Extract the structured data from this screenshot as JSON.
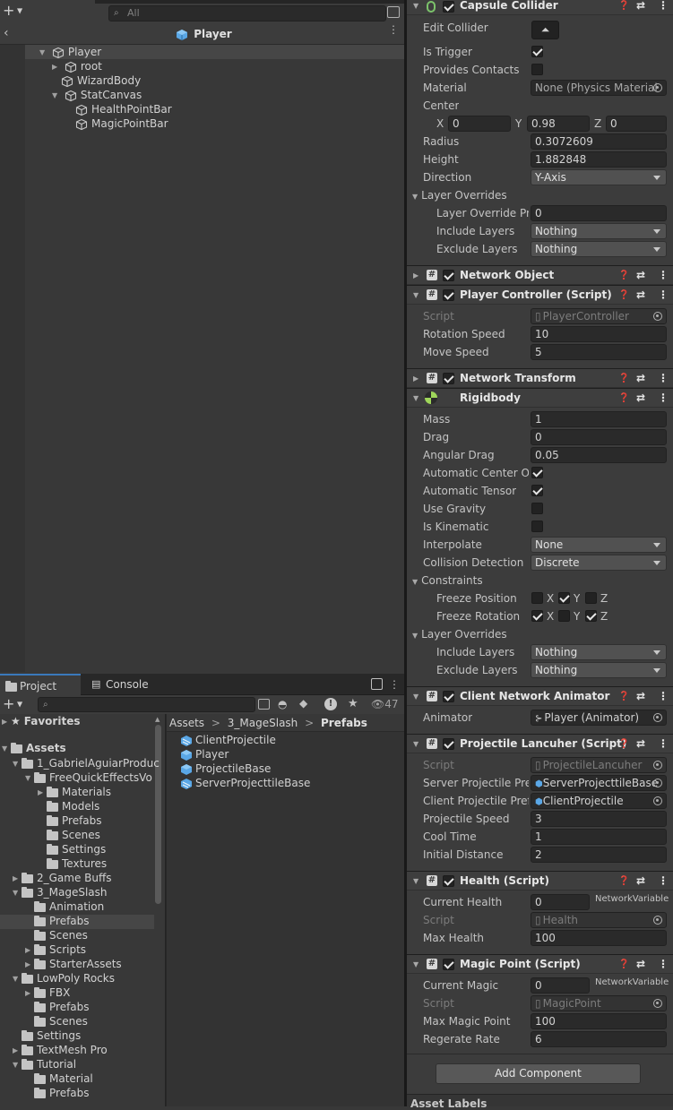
{
  "hierarchy": {
    "search_placeholder": "All",
    "header_title": "Player",
    "items": [
      {
        "label": "Player",
        "depth": 0
      },
      {
        "label": "root",
        "depth": 1
      },
      {
        "label": "WizardBody",
        "depth": 1
      },
      {
        "label": "StatCanvas",
        "depth": 1
      },
      {
        "label": "HealthPointBar",
        "depth": 2
      },
      {
        "label": "MagicPointBar",
        "depth": 2
      }
    ]
  },
  "project": {
    "tabs": [
      "Project",
      "Console"
    ],
    "hidden_count": "47",
    "breadcrumb": [
      "Assets",
      "3_MageSlash",
      "Prefabs"
    ],
    "favorites_label": "Favorites",
    "tree": [
      {
        "label": "Assets"
      },
      {
        "label": "1_GabrielAguiarProduc"
      },
      {
        "label": "FreeQuickEffectsVo"
      },
      {
        "label": "Materials"
      },
      {
        "label": "Models"
      },
      {
        "label": "Prefabs"
      },
      {
        "label": "Scenes"
      },
      {
        "label": "Settings"
      },
      {
        "label": "Textures"
      },
      {
        "label": "2_Game Buffs"
      },
      {
        "label": "3_MageSlash"
      },
      {
        "label": "Animation"
      },
      {
        "label": "Prefabs"
      },
      {
        "label": "Scenes"
      },
      {
        "label": "Scripts"
      },
      {
        "label": "StarterAssets"
      },
      {
        "label": "LowPoly Rocks"
      },
      {
        "label": "FBX"
      },
      {
        "label": "Prefabs"
      },
      {
        "label": "Scenes"
      },
      {
        "label": "Settings"
      },
      {
        "label": "TextMesh Pro"
      },
      {
        "label": "Tutorial"
      },
      {
        "label": "Material"
      },
      {
        "label": "Prefabs"
      }
    ],
    "files": [
      "ClientProjectile",
      "Player",
      "ProjectileBase",
      "ServerProjecttileBase"
    ]
  },
  "inspector": {
    "capsule": {
      "title": "Capsule Collider",
      "edit_collider": "Edit Collider",
      "is_trigger": "Is Trigger",
      "provides_contacts": "Provides Contacts",
      "material_label": "Material",
      "material_value": "None (Physics Material",
      "center_label": "Center",
      "center_x": "0",
      "center_y": "0.98",
      "center_z": "0",
      "radius_label": "Radius",
      "radius": "0.3072609",
      "height_label": "Height",
      "height": "1.882848",
      "direction_label": "Direction",
      "direction": "Y-Axis",
      "layer_overrides": "Layer Overrides",
      "priority_label": "Layer Override Pric",
      "priority": "0",
      "include_label": "Include Layers",
      "include": "Nothing",
      "exclude_label": "Exclude Layers",
      "exclude": "Nothing"
    },
    "network_object": {
      "title": "Network Object"
    },
    "player_controller": {
      "title": "Player Controller (Script)",
      "script_label": "Script",
      "script": "PlayerController",
      "rotation_label": "Rotation Speed",
      "rotation": "10",
      "move_label": "Move Speed",
      "move": "5"
    },
    "network_transform": {
      "title": "Network Transform"
    },
    "rigidbody": {
      "title": "Rigidbody",
      "mass_label": "Mass",
      "mass": "1",
      "drag_label": "Drag",
      "drag": "0",
      "angular_label": "Angular Drag",
      "angular": "0.05",
      "auto_center": "Automatic Center Of",
      "auto_tensor": "Automatic Tensor",
      "use_gravity": "Use Gravity",
      "is_kinematic": "Is Kinematic",
      "interpolate_label": "Interpolate",
      "interpolate": "None",
      "collision_label": "Collision Detection",
      "collision": "Discrete",
      "constraints": "Constraints",
      "freeze_pos": "Freeze Position",
      "freeze_rot": "Freeze Rotation",
      "axis_x": "X",
      "axis_y": "Y",
      "axis_z": "Z",
      "layer_overrides": "Layer Overrides",
      "include_label": "Include Layers",
      "include": "Nothing",
      "exclude_label": "Exclude Layers",
      "exclude": "Nothing"
    },
    "client_animator": {
      "title": "Client Network Animator (Scr",
      "animator_label": "Animator",
      "animator": "Player (Animator)"
    },
    "projectile_launcher": {
      "title": "Projectile Lancuher (Script)",
      "script_label": "Script",
      "script": "ProjectileLancuher",
      "server_label": "Server Projectile Pref",
      "server": "ServerProjecttileBase",
      "client_label": "Client Projectile Prefa",
      "client": "ClientProjectile",
      "speed_label": "Projectile Speed",
      "speed": "3",
      "cool_label": "Cool Time",
      "cool": "1",
      "dist_label": "Initial Distance",
      "dist": "2"
    },
    "health": {
      "title": "Health (Script)",
      "current_label": "Current Health",
      "current": "0",
      "netvar": "NetworkVariable",
      "script_label": "Script",
      "script": "Health",
      "max_label": "Max Health",
      "max": "100"
    },
    "magic": {
      "title": "Magic Point (Script)",
      "current_label": "Current Magic",
      "current": "0",
      "netvar": "NetworkVariable",
      "script_label": "Script",
      "script": "MagicPoint",
      "max_label": "Max Magic Point",
      "max": "100",
      "regen_label": "Regerate Rate",
      "regen": "6"
    },
    "add_component": "Add Component",
    "asset_labels": "Asset Labels"
  }
}
